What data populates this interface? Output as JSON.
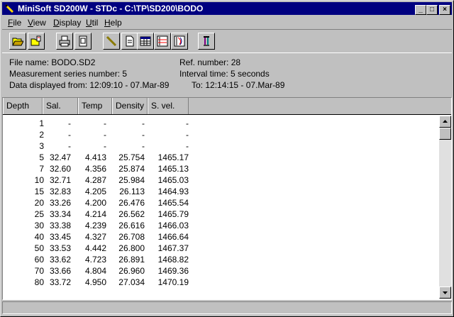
{
  "window": {
    "title": "MiniSoft SD200W - STDc - C:\\TP\\SD200\\BODO"
  },
  "menu": [
    {
      "label": "File",
      "accel": "F",
      "rest": "ile"
    },
    {
      "label": "View",
      "accel": "V",
      "rest": "iew"
    },
    {
      "label": "Display",
      "accel": "D",
      "rest": "isplay"
    },
    {
      "label": "Util",
      "accel": "U",
      "rest": "til"
    },
    {
      "label": "Help",
      "accel": "H",
      "rest": "elp"
    }
  ],
  "toolbar": {
    "buttons": [
      "open-folder-icon",
      "open-file-icon",
      "print-icon",
      "print-preview-icon",
      "pen-icon",
      "document-icon",
      "table-icon",
      "graph-icon",
      "profile-graph-icon",
      "instrument-icon"
    ]
  },
  "info": {
    "file_name": "File name: BODO.SD2",
    "ref_number": "Ref. number: 28",
    "series_number": "Measurement series number: 5",
    "interval_time": "Interval time: 5 seconds",
    "displayed_from": "Data displayed from: 12:09:10 - 07.Mar-89",
    "displayed_to": "To: 12:14:15 - 07.Mar-89"
  },
  "table": {
    "columns": [
      "Depth",
      "Sal.",
      "Temp",
      "Density",
      "S. vel."
    ],
    "rows": [
      [
        "1",
        "-",
        "-",
        "-",
        "-"
      ],
      [
        "2",
        "-",
        "-",
        "-",
        "-"
      ],
      [
        "3",
        "-",
        "-",
        "-",
        "-"
      ],
      [
        "5",
        "32.47",
        "4.413",
        "25.754",
        "1465.17"
      ],
      [
        "7",
        "32.60",
        "4.356",
        "25.874",
        "1465.13"
      ],
      [
        "10",
        "32.71",
        "4.287",
        "25.984",
        "1465.03"
      ],
      [
        "15",
        "32.83",
        "4.205",
        "26.113",
        "1464.93"
      ],
      [
        "20",
        "33.26",
        "4.200",
        "26.476",
        "1465.54"
      ],
      [
        "25",
        "33.34",
        "4.214",
        "26.562",
        "1465.79"
      ],
      [
        "30",
        "33.38",
        "4.239",
        "26.616",
        "1466.03"
      ],
      [
        "40",
        "33.45",
        "4.327",
        "26.708",
        "1466.64"
      ],
      [
        "50",
        "33.53",
        "4.442",
        "26.800",
        "1467.37"
      ],
      [
        "60",
        "33.62",
        "4.723",
        "26.891",
        "1468.82"
      ],
      [
        "70",
        "33.66",
        "4.804",
        "26.960",
        "1469.36"
      ],
      [
        "80",
        "33.72",
        "4.950",
        "27.034",
        "1470.19"
      ]
    ]
  },
  "colors": {
    "titlebar": "#000080",
    "face": "#c0c0c0"
  }
}
